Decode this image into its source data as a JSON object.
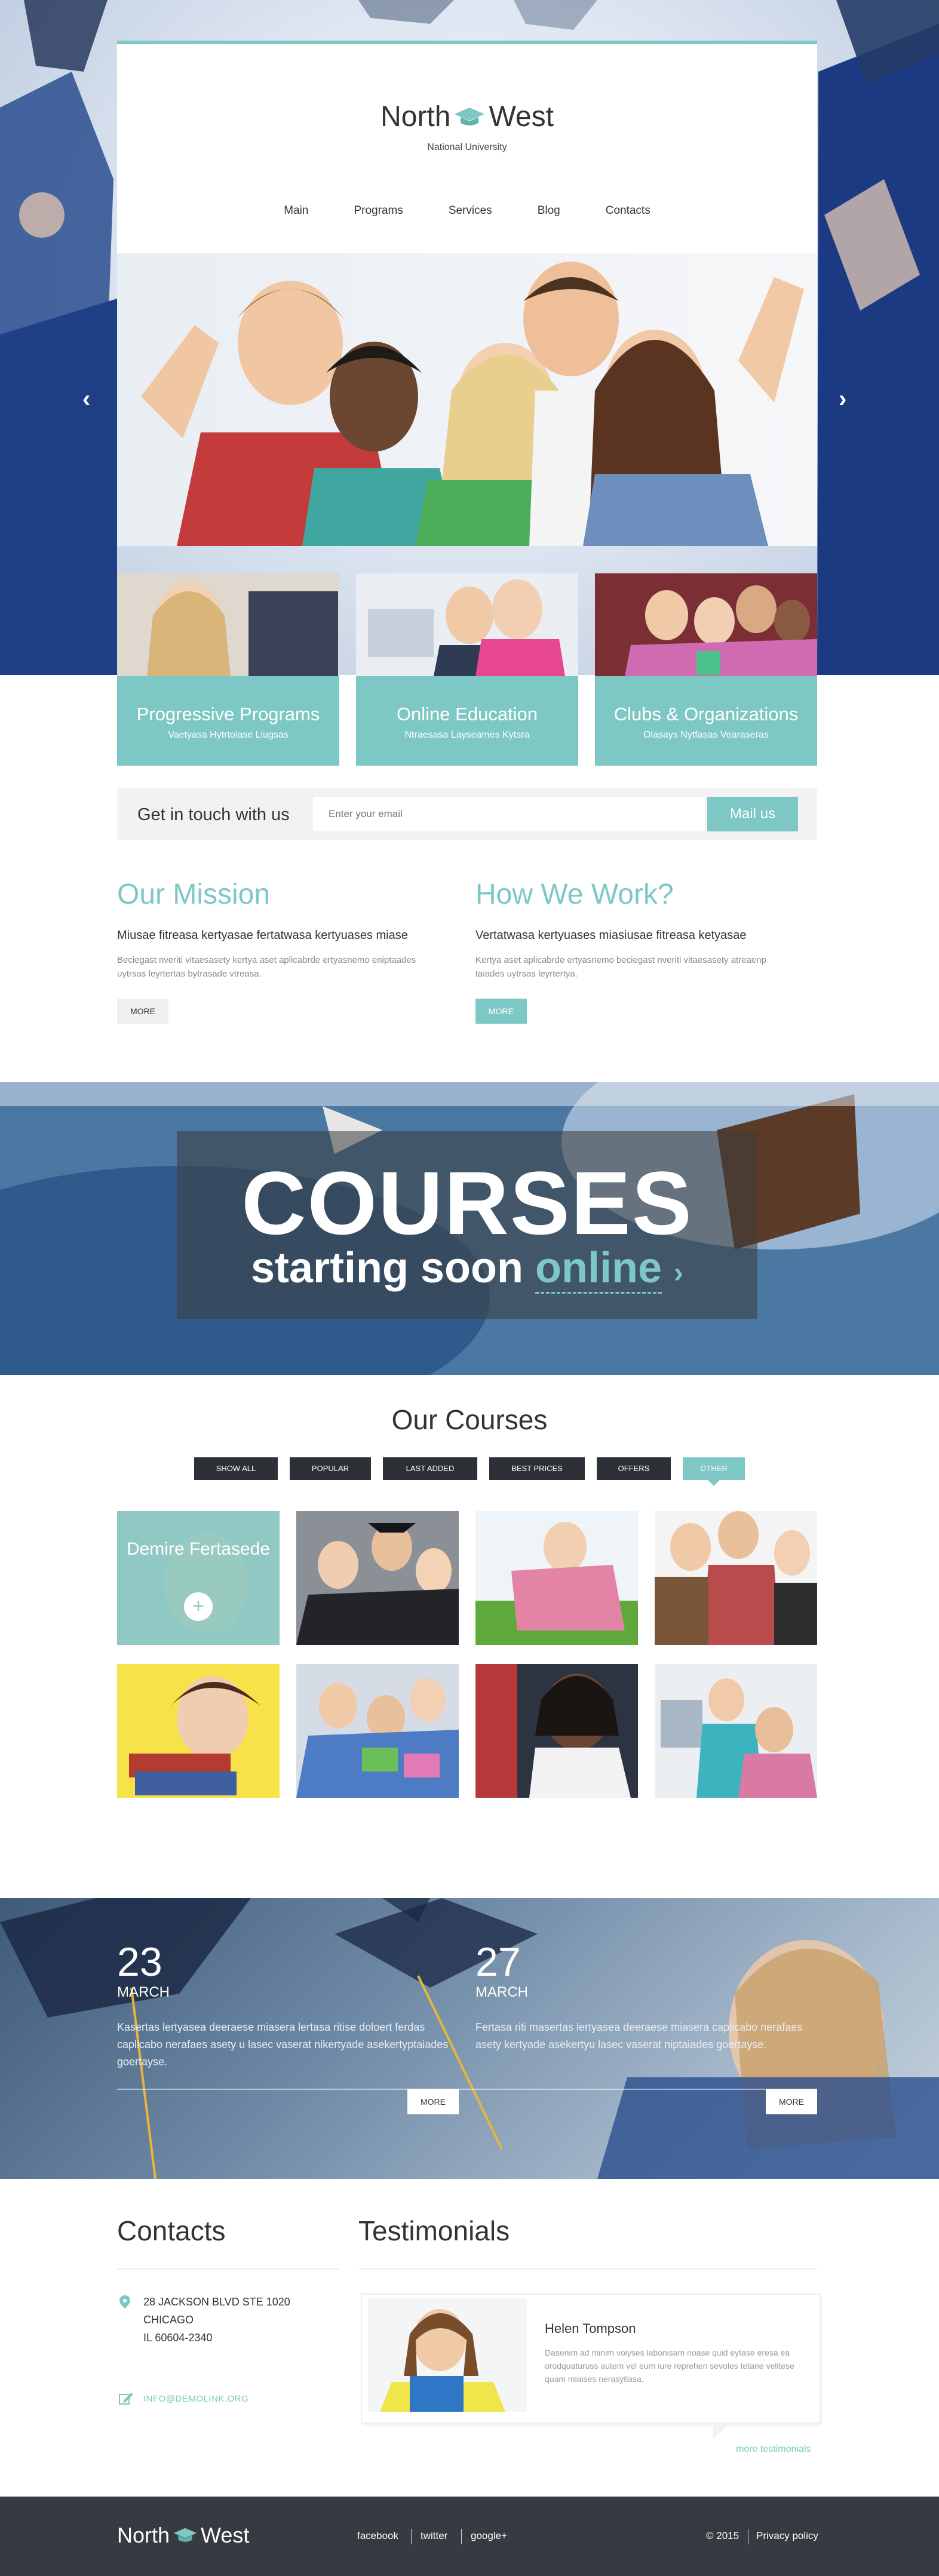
{
  "brand": {
    "name_left": "North",
    "name_right": "West",
    "subtitle": "National University",
    "accent": "#7dc8c4",
    "logo_icon": "graduation-cap-icon"
  },
  "nav": [
    "Main",
    "Programs",
    "Services",
    "Blog",
    "Contacts"
  ],
  "slider": {
    "prev_icon": "chevron-left-icon",
    "next_icon": "chevron-right-icon"
  },
  "promos": [
    {
      "title": "Progressive Programs",
      "subtitle": "Vaetyasa Hytrtoiase Liugsas"
    },
    {
      "title": "Online Education",
      "subtitle": "Ntraesasa Layseames Kytsra"
    },
    {
      "title": "Clubs & Organizations",
      "subtitle": "Olasays Nytfasas Vearaseras"
    }
  ],
  "touch": {
    "label": "Get in touch with us",
    "placeholder": "Enter your email",
    "button": "Mail us"
  },
  "mission": {
    "title": "Our Mission",
    "lead": "Miusae fitreasa kertyasae fertatwasa kertyuases miase",
    "text": "Beciegast nveriti vitaesasety kertya aset aplicabrde ertyasnemo eniptaades uytrsas leyrtertas bytrasade vtreasa.",
    "button": "MORE"
  },
  "how": {
    "title": "How We Work?",
    "lead": "Vertatwasa kertyuases miasiusae fitreasa ketyasae",
    "text": "Kertya aset aplicabrde ertyasnemo beciegast nveriti vitaesasety atreaenp taiades uytrsas leyrtertya.",
    "button": "MORE"
  },
  "banner": {
    "title": "COURSES",
    "sub_prefix": "starting soon",
    "sub_link": "online",
    "sub_arrow": "›"
  },
  "courses": {
    "title": "Our Courses",
    "filters": [
      "SHOW ALL",
      "POPULAR",
      "LAST ADDED",
      "BEST PRICES",
      "OFFERS",
      "OTHER"
    ],
    "active_filter": "OTHER",
    "first_item_name": "Demire Fertasede",
    "first_item_plus": "+"
  },
  "events": [
    {
      "day": "23",
      "month": "MARCH",
      "text": "Kasertas lertyasea deeraese miasera lertasa ritise doloert ferdas caplicabo nerafaes asety u lasec vaserat nikertyade asekertyptaiades goertayse.",
      "button": "MORE"
    },
    {
      "day": "27",
      "month": "MARCH",
      "text": "Fertasa riti masertas lertyasea deeraese miasera caplicabo nerafaes asety kertyade asekertyu lasec vaserat niptaiades goertayse.",
      "button": "MORE"
    }
  ],
  "contacts": {
    "title": "Contacts",
    "address": [
      "28 JACKSON BLVD STE 1020",
      "CHICAGO",
      "IL 60604-2340"
    ],
    "email": "INFO@DEMOLINK.ORG",
    "location_icon": "map-pin-icon",
    "email_icon": "pencil-icon"
  },
  "testimonials": {
    "title": "Testimonials",
    "name": "Helen Tompson",
    "text": "Dasenim ad minim voiyses labonisam noase quid eytase eresa ea orodquaturuss autem vel eum iure reprehen sevoles tetane velitese quam miaises nerasytlasa.",
    "more": "more testimonials"
  },
  "footer": {
    "links": [
      "facebook",
      "twitter",
      "google+"
    ],
    "copyright": "© 2015",
    "privacy": "Privacy policy"
  }
}
